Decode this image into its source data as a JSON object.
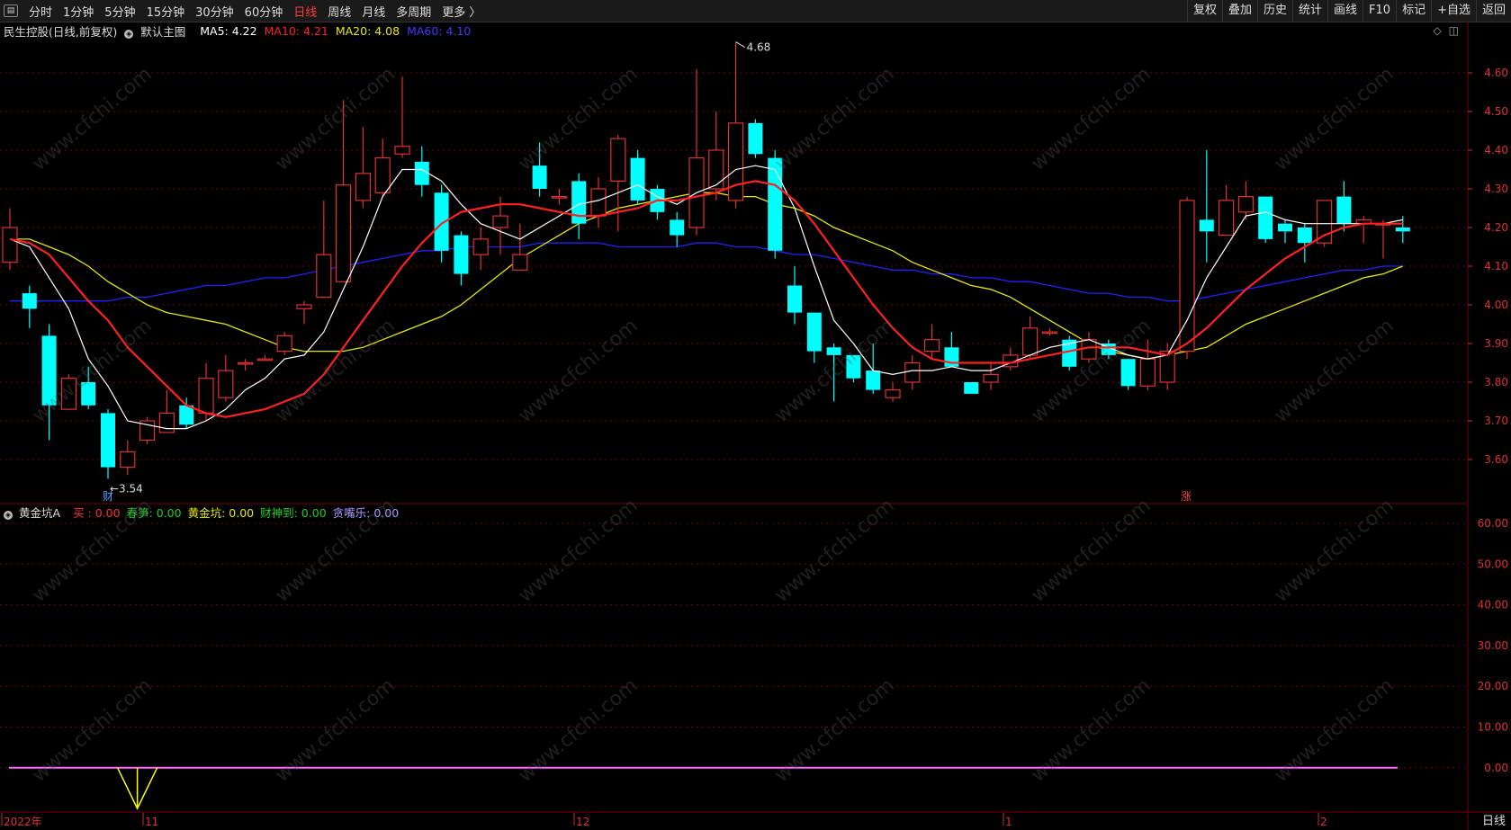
{
  "toolbar": {
    "periods": [
      "分时",
      "1分钟",
      "5分钟",
      "15分钟",
      "30分钟",
      "60分钟",
      "日线",
      "周线",
      "月线",
      "多周期",
      "更多 〉"
    ],
    "active_period": "日线",
    "right_buttons": [
      "复权",
      "叠加",
      "历史",
      "统计",
      "画线",
      "F10",
      "标记",
      "+自选",
      "返回"
    ]
  },
  "main_info": {
    "stock_title": "民生控股(日线,前复权)",
    "template": "默认主图",
    "ma5": "MA5: 4.22",
    "ma10": "MA10: 4.21",
    "ma20": "MA20: 4.08",
    "ma60": "MA60: 4.10"
  },
  "indicator_info": {
    "name": "黄金坑A",
    "buy": "买 : 0.00",
    "spring": "春笋: 0.00",
    "pit": "黄金坑: 0.00",
    "wealth": "财神到: 0.00",
    "greed": "贪嘴乐: 0.00"
  },
  "colors": {
    "up": "#e0302f",
    "down": "#00ffff",
    "ma5": "#ffffff",
    "ma10": "#ff2020",
    "ma20": "#e8e800",
    "ma60": "#2020ff",
    "grid": "#7a0000",
    "ind_line": "#ff66ff",
    "ind_pit": "#ffff00"
  },
  "axis": {
    "price_ticks": [
      "4.60",
      "4.50",
      "4.40",
      "4.30",
      "4.20",
      "4.10",
      "4.00",
      "3.90",
      "3.80",
      "3.70",
      "3.60"
    ],
    "ind_ticks": [
      "60.00",
      "50.00",
      "40.00",
      "30.00",
      "20.00",
      "10.00",
      "0.00"
    ],
    "date_labels": [
      "2022年",
      "11",
      "12",
      "1",
      "2"
    ],
    "bottom_right": "日线"
  },
  "annotations": {
    "high": "4.68",
    "low": "←3.54",
    "cai_mark": "财",
    "zhang_mark": "涨"
  },
  "watermark": "www.cfchi.com",
  "chart_data": {
    "type": "candlestick",
    "price_range": [
      3.5,
      4.7
    ],
    "indicator_range": [
      -10,
      70
    ],
    "candles": [
      [
        4.11,
        4.2,
        4.25,
        4.09
      ],
      [
        4.03,
        3.99,
        4.05,
        3.94
      ],
      [
        3.92,
        3.74,
        3.95,
        3.65
      ],
      [
        3.73,
        3.81,
        3.82,
        3.73
      ],
      [
        3.8,
        3.74,
        3.84,
        3.73
      ],
      [
        3.72,
        3.58,
        3.73,
        3.55
      ],
      [
        3.58,
        3.62,
        3.65,
        3.56
      ],
      [
        3.65,
        3.7,
        3.71,
        3.64
      ],
      [
        3.67,
        3.72,
        3.78,
        3.67
      ],
      [
        3.74,
        3.69,
        3.76,
        3.68
      ],
      [
        3.72,
        3.81,
        3.85,
        3.7
      ],
      [
        3.76,
        3.83,
        3.87,
        3.75
      ],
      [
        3.85,
        3.85,
        3.86,
        3.83
      ],
      [
        3.86,
        3.86,
        3.87,
        3.86
      ],
      [
        3.88,
        3.92,
        3.93,
        3.87
      ],
      [
        3.99,
        4.0,
        4.01,
        3.95
      ],
      [
        4.02,
        4.13,
        4.27,
        4.02
      ],
      [
        4.06,
        4.31,
        4.53,
        4.06
      ],
      [
        4.27,
        4.34,
        4.46,
        4.25
      ],
      [
        4.29,
        4.38,
        4.43,
        4.28
      ],
      [
        4.39,
        4.41,
        4.59,
        4.38
      ],
      [
        4.37,
        4.31,
        4.41,
        4.28
      ],
      [
        4.29,
        4.14,
        4.31,
        4.11
      ],
      [
        4.18,
        4.08,
        4.19,
        4.05
      ],
      [
        4.13,
        4.17,
        4.2,
        4.09
      ],
      [
        4.2,
        4.23,
        4.28,
        4.13
      ],
      [
        4.09,
        4.13,
        4.21,
        4.09
      ],
      [
        4.36,
        4.3,
        4.42,
        4.28
      ],
      [
        4.28,
        4.28,
        4.3,
        4.26
      ],
      [
        4.32,
        4.21,
        4.34,
        4.17
      ],
      [
        4.23,
        4.3,
        4.33,
        4.2
      ],
      [
        4.32,
        4.43,
        4.44,
        4.19
      ],
      [
        4.38,
        4.27,
        4.4,
        4.26
      ],
      [
        4.3,
        4.24,
        4.31,
        4.22
      ],
      [
        4.22,
        4.18,
        4.24,
        4.15
      ],
      [
        4.2,
        4.38,
        4.61,
        4.18
      ],
      [
        4.3,
        4.4,
        4.5,
        4.27
      ],
      [
        4.27,
        4.47,
        4.68,
        4.25
      ],
      [
        4.47,
        4.39,
        4.48,
        4.38
      ],
      [
        4.38,
        4.14,
        4.4,
        4.12
      ],
      [
        4.05,
        3.98,
        4.1,
        3.95
      ],
      [
        3.98,
        3.88,
        3.98,
        3.85
      ],
      [
        3.89,
        3.87,
        3.9,
        3.75
      ],
      [
        3.87,
        3.81,
        3.87,
        3.8
      ],
      [
        3.83,
        3.78,
        3.9,
        3.77
      ],
      [
        3.76,
        3.78,
        3.8,
        3.75
      ],
      [
        3.8,
        3.85,
        3.87,
        3.78
      ],
      [
        3.88,
        3.91,
        3.95,
        3.86
      ],
      [
        3.89,
        3.84,
        3.93,
        3.84
      ],
      [
        3.8,
        3.77,
        3.8,
        3.77
      ],
      [
        3.8,
        3.82,
        3.85,
        3.78
      ],
      [
        3.84,
        3.87,
        3.89,
        3.83
      ],
      [
        3.87,
        3.94,
        3.97,
        3.86
      ],
      [
        3.93,
        3.93,
        3.94,
        3.92
      ],
      [
        3.91,
        3.84,
        3.92,
        3.83
      ],
      [
        3.86,
        3.91,
        3.93,
        3.85
      ],
      [
        3.9,
        3.87,
        3.91,
        3.86
      ],
      [
        3.86,
        3.79,
        3.86,
        3.78
      ],
      [
        3.79,
        3.86,
        3.91,
        3.78
      ],
      [
        3.8,
        3.88,
        3.9,
        3.78
      ],
      [
        3.88,
        4.27,
        4.28,
        3.86
      ],
      [
        4.22,
        4.19,
        4.4,
        4.11
      ],
      [
        4.18,
        4.27,
        4.31,
        4.18
      ],
      [
        4.24,
        4.28,
        4.32,
        4.22
      ],
      [
        4.28,
        4.17,
        4.28,
        4.16
      ],
      [
        4.21,
        4.19,
        4.22,
        4.16
      ],
      [
        4.2,
        4.16,
        4.21,
        4.11
      ],
      [
        4.16,
        4.27,
        4.27,
        4.15
      ],
      [
        4.28,
        4.21,
        4.32,
        4.19
      ],
      [
        4.21,
        4.22,
        4.23,
        4.16
      ],
      [
        4.21,
        4.21,
        4.22,
        4.12
      ],
      [
        4.2,
        4.19,
        4.23,
        4.16
      ]
    ],
    "ma5": [
      4.17,
      4.15,
      4.07,
      3.99,
      3.86,
      3.79,
      3.7,
      3.69,
      3.68,
      3.68,
      3.7,
      3.73,
      3.78,
      3.81,
      3.86,
      3.87,
      3.93,
      4.04,
      4.15,
      4.28,
      4.35,
      4.35,
      4.32,
      4.26,
      4.21,
      4.19,
      4.17,
      4.2,
      4.23,
      4.26,
      4.27,
      4.29,
      4.31,
      4.28,
      4.26,
      4.29,
      4.31,
      4.35,
      4.36,
      4.35,
      4.25,
      4.1,
      3.96,
      3.9,
      3.83,
      3.82,
      3.83,
      3.83,
      3.84,
      3.83,
      3.83,
      3.85,
      3.87,
      3.89,
      3.9,
      3.91,
      3.89,
      3.87,
      3.86,
      3.87,
      3.96,
      4.07,
      4.15,
      4.23,
      4.24,
      4.22,
      4.21,
      4.21,
      4.21,
      4.21,
      4.21,
      4.22
    ],
    "ma10": [
      4.17,
      4.16,
      4.13,
      4.07,
      4.01,
      3.96,
      3.89,
      3.84,
      3.79,
      3.74,
      3.72,
      3.71,
      3.72,
      3.73,
      3.75,
      3.77,
      3.82,
      3.89,
      3.96,
      4.03,
      4.1,
      4.16,
      4.21,
      4.24,
      4.25,
      4.26,
      4.26,
      4.25,
      4.24,
      4.23,
      4.23,
      4.24,
      4.25,
      4.27,
      4.27,
      4.28,
      4.29,
      4.31,
      4.32,
      4.31,
      4.27,
      4.21,
      4.14,
      4.07,
      4.0,
      3.94,
      3.89,
      3.86,
      3.85,
      3.85,
      3.85,
      3.85,
      3.86,
      3.87,
      3.88,
      3.89,
      3.89,
      3.89,
      3.88,
      3.87,
      3.9,
      3.94,
      3.99,
      4.04,
      4.08,
      4.12,
      4.15,
      4.18,
      4.2,
      4.21,
      4.21,
      4.21
    ],
    "ma20": [
      4.17,
      4.17,
      4.15,
      4.13,
      4.1,
      4.06,
      4.03,
      4.0,
      3.98,
      3.97,
      3.96,
      3.95,
      3.93,
      3.91,
      3.89,
      3.88,
      3.88,
      3.88,
      3.89,
      3.91,
      3.93,
      3.95,
      3.97,
      4.0,
      4.04,
      4.08,
      4.12,
      4.15,
      4.18,
      4.21,
      4.23,
      4.25,
      4.26,
      4.27,
      4.28,
      4.29,
      4.29,
      4.28,
      4.28,
      4.26,
      4.25,
      4.23,
      4.2,
      4.18,
      4.16,
      4.14,
      4.11,
      4.09,
      4.07,
      4.05,
      4.04,
      4.02,
      3.99,
      3.96,
      3.93,
      3.9,
      3.88,
      3.87,
      3.86,
      3.87,
      3.88,
      3.89,
      3.92,
      3.95,
      3.97,
      3.99,
      4.01,
      4.03,
      4.05,
      4.07,
      4.08,
      4.1
    ],
    "ma60": [
      4.01,
      4.01,
      4.01,
      4.01,
      4.01,
      4.01,
      4.02,
      4.02,
      4.03,
      4.04,
      4.05,
      4.05,
      4.06,
      4.07,
      4.07,
      4.08,
      4.09,
      4.1,
      4.11,
      4.12,
      4.13,
      4.14,
      4.14,
      4.15,
      4.15,
      4.15,
      4.15,
      4.16,
      4.16,
      4.16,
      4.16,
      4.15,
      4.15,
      4.15,
      4.15,
      4.16,
      4.16,
      4.15,
      4.15,
      4.14,
      4.13,
      4.13,
      4.12,
      4.11,
      4.1,
      4.09,
      4.09,
      4.08,
      4.08,
      4.07,
      4.07,
      4.06,
      4.06,
      4.05,
      4.04,
      4.03,
      4.03,
      4.02,
      4.02,
      4.01,
      4.01,
      4.02,
      4.03,
      4.04,
      4.05,
      4.06,
      4.07,
      4.08,
      4.09,
      4.09,
      4.1,
      4.1
    ],
    "indicator_line": 0,
    "pit_spike": {
      "index": 7,
      "value": -10
    }
  }
}
